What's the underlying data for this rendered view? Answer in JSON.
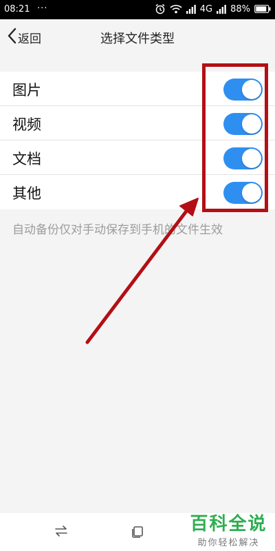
{
  "status_bar": {
    "time": "08:21",
    "dots": "···",
    "network": "4G",
    "battery_pct": "88%"
  },
  "header": {
    "back_label": "返回",
    "title": "选择文件类型"
  },
  "file_types": [
    {
      "label": "图片",
      "enabled": true
    },
    {
      "label": "视频",
      "enabled": true
    },
    {
      "label": "文档",
      "enabled": true
    },
    {
      "label": "其他",
      "enabled": true
    }
  ],
  "note": "自动备份仅对手动保存到手机的文件生效",
  "colors": {
    "toggle_on": "#2f8ff0",
    "annotation": "#b30f15",
    "watermark": "#2eae50"
  },
  "icons": {
    "back": "chevron-left-icon",
    "alarm": "alarm-clock-icon",
    "wifi": "wifi-icon",
    "signal": "signal-icon",
    "battery": "battery-icon",
    "switch": "switch-arrows-icon",
    "recent": "recent-apps-icon"
  },
  "watermark": {
    "main": "百科全说",
    "sub": "助你轻松解决"
  }
}
